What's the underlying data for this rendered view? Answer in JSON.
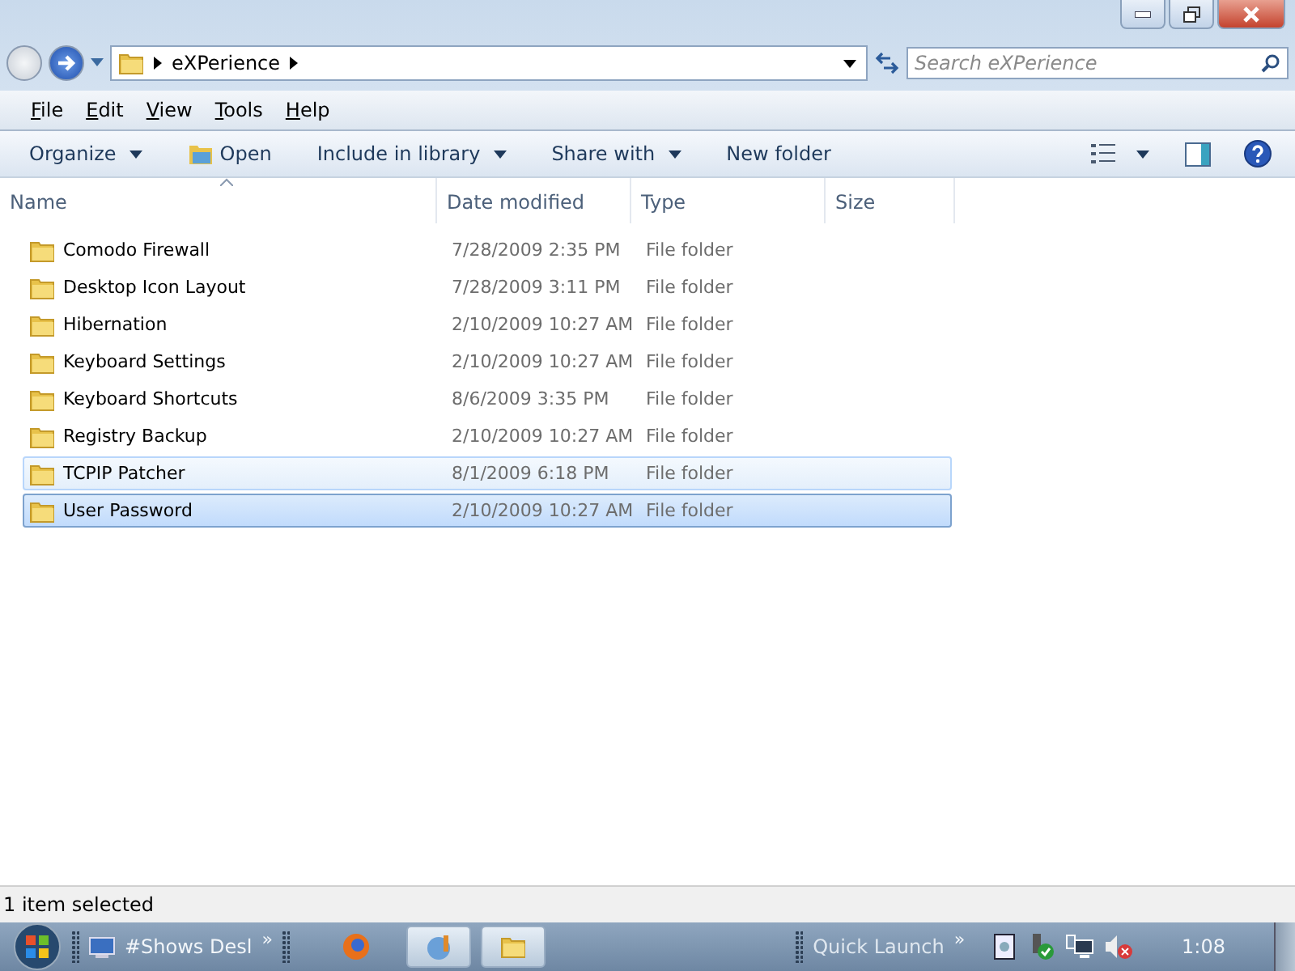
{
  "address": {
    "crumbs": [
      "eXPerience"
    ]
  },
  "search": {
    "placeholder": "Search eXPerience"
  },
  "menu": [
    "File",
    "Edit",
    "View",
    "Tools",
    "Help"
  ],
  "toolbar": [
    {
      "label": "Organize",
      "kind": "dropdown"
    },
    {
      "label": "Open",
      "kind": "icon"
    },
    {
      "label": "Include in library",
      "kind": "dropdown"
    },
    {
      "label": "Share with",
      "kind": "dropdown"
    },
    {
      "label": "New folder",
      "kind": "plain"
    }
  ],
  "columns": [
    "Name",
    "Date modified",
    "Type",
    "Size"
  ],
  "rows": [
    {
      "name": "Comodo Firewall",
      "date": "7/28/2009 2:35 PM",
      "type": "File folder",
      "selected": false,
      "hovered": false
    },
    {
      "name": "Desktop Icon Layout",
      "date": "7/28/2009 3:11 PM",
      "type": "File folder",
      "selected": false,
      "hovered": false
    },
    {
      "name": "Hibernation",
      "date": "2/10/2009 10:27 AM",
      "type": "File folder",
      "selected": false,
      "hovered": false
    },
    {
      "name": "Keyboard Settings",
      "date": "2/10/2009 10:27 AM",
      "type": "File folder",
      "selected": false,
      "hovered": false
    },
    {
      "name": "Keyboard Shortcuts",
      "date": "8/6/2009 3:35 PM",
      "type": "File folder",
      "selected": false,
      "hovered": false
    },
    {
      "name": "Registry Backup",
      "date": "2/10/2009 10:27 AM",
      "type": "File folder",
      "selected": false,
      "hovered": false
    },
    {
      "name": "TCPIP Patcher",
      "date": "8/1/2009 6:18 PM",
      "type": "File folder",
      "selected": false,
      "hovered": true
    },
    {
      "name": "User Password",
      "date": "2/10/2009 10:27 AM",
      "type": "File folder",
      "selected": true,
      "hovered": false
    }
  ],
  "status_bar": "1 item selected",
  "taskbar": {
    "toolbar_label": "#Shows Desl",
    "toolbar_chevron": "»",
    "quick_launch": "Quick Launch",
    "quick_chevron": "»",
    "clock": "1:08"
  }
}
